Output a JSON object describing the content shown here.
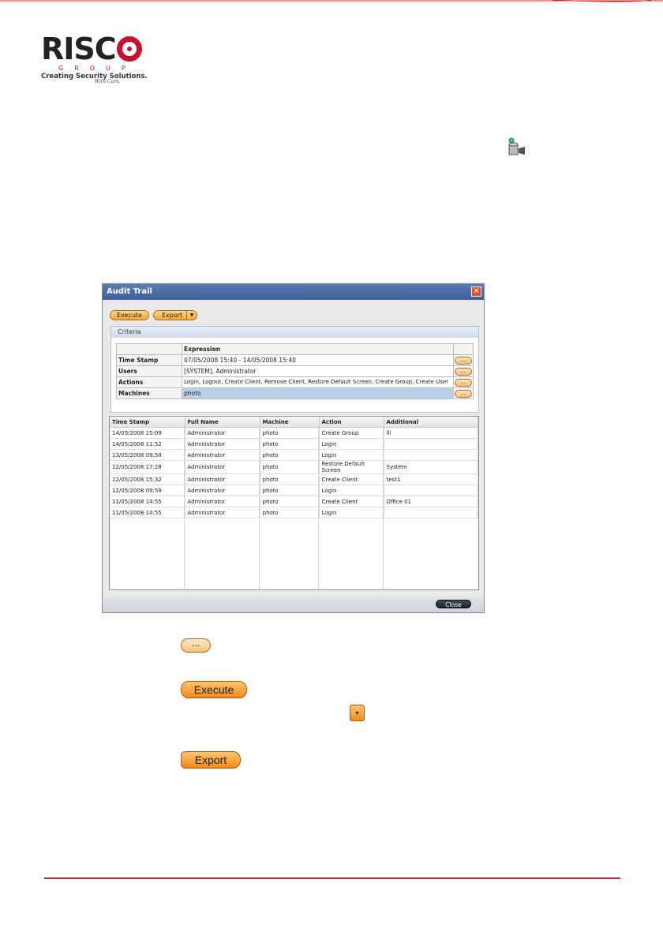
{
  "logo": {
    "name": "RISC",
    "group": "GROUP",
    "tagline": "Creating Security Solutions.",
    "signature": "With Care."
  },
  "dialog": {
    "title": "Audit Trail",
    "execute_label": "Execute",
    "export_label": "Export",
    "criteria_label": "Criteria",
    "criteria_header": "Expression",
    "criteria_rows": [
      {
        "label": "Time Stamp",
        "value": "07/05/2008 15:40 - 14/05/2008 15:40",
        "button": "..."
      },
      {
        "label": "Users",
        "value": "[SYSTEM], Administrator",
        "button": "..."
      },
      {
        "label": "Actions",
        "value": "Login, Logout, Create Client, Remove Client, Restore Default Screen, Create Group, Create User",
        "button": "..."
      },
      {
        "label": "Machines",
        "value": "photo",
        "button": "..."
      }
    ],
    "result_columns": [
      "Time Stamp",
      "Full Name",
      "Machine",
      "Action",
      "Additional"
    ],
    "result_rows": [
      [
        "14/05/2008 15:09",
        "Administrator",
        "photo",
        "Create Group",
        "lll"
      ],
      [
        "14/05/2008 11:52",
        "Administrator",
        "photo",
        "Login",
        ""
      ],
      [
        "13/05/2008 09:59",
        "Administrator",
        "photo",
        "Login",
        ""
      ],
      [
        "12/05/2008 17:28",
        "Administrator",
        "photo",
        "Restore Default Screen",
        "System"
      ],
      [
        "12/05/2008 15:32",
        "Administrator",
        "photo",
        "Create Client",
        "test1"
      ],
      [
        "12/05/2008 09:59",
        "Administrator",
        "photo",
        "Login",
        ""
      ],
      [
        "11/05/2008 14:55",
        "Administrator",
        "photo",
        "Create Client",
        "Office 01"
      ],
      [
        "11/05/2008 14:55",
        "Administrator",
        "photo",
        "Login",
        ""
      ]
    ],
    "close_label": "Close"
  },
  "legend": {
    "dots_label": "...",
    "execute_label": "Execute",
    "dropdown_arrow": "▾",
    "export_label": "Export"
  },
  "colors": {
    "accent": "#c3302b",
    "button_orange": "#f08a1c",
    "titlebar": "#3e5f99"
  }
}
